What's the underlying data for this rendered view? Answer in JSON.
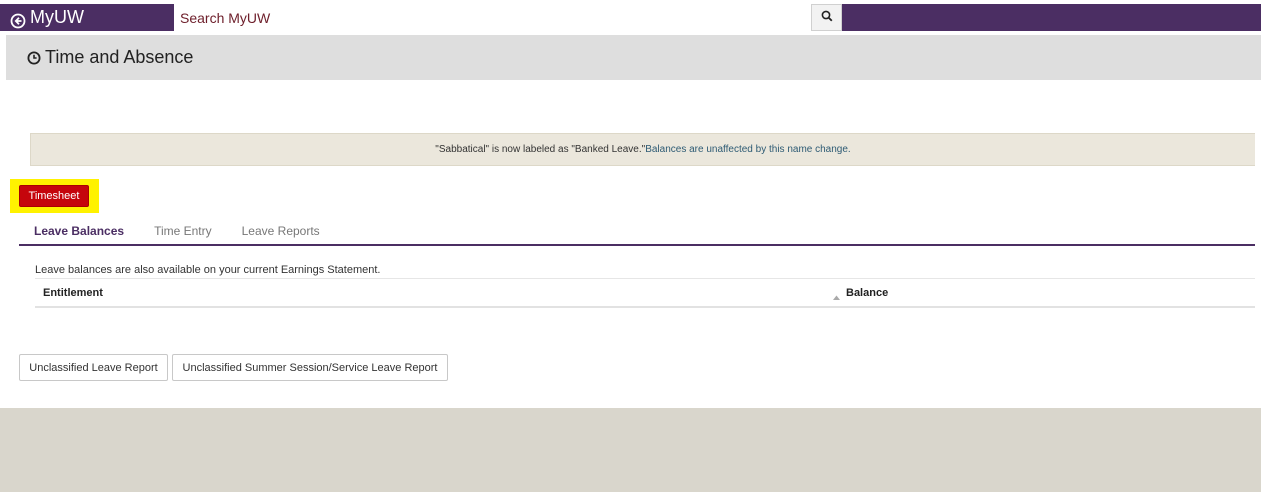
{
  "topbar": {
    "brand": "MyUW",
    "brand_icon": "back-arrow-circle-icon",
    "search_placeholder": "Search MyUW",
    "search_icon": "search-icon",
    "brand_color": "#4b2e63"
  },
  "page": {
    "title": "Time and Absence",
    "title_icon": "clock-icon"
  },
  "notice": {
    "quoted": "\"Sabbatical\" is now labeled as \"Banked Leave.\"",
    "rest": " Balances are unaffected by this name change."
  },
  "timesheet_button": {
    "label": "Timesheet",
    "color": "#c5050c",
    "highlight_color": "#fff200"
  },
  "tabs": [
    {
      "label": "Leave Balances",
      "active": true
    },
    {
      "label": "Time Entry",
      "active": false
    },
    {
      "label": "Leave Reports",
      "active": false
    }
  ],
  "leave_balances": {
    "note": "Leave balances are also available on your current Earnings Statement.",
    "columns": [
      "Entitlement",
      "Balance"
    ],
    "sort_icon": "sort-up-icon"
  },
  "report_buttons": [
    "Unclassified Leave Report",
    "Unclassified Summer Session/Service Leave Report"
  ]
}
